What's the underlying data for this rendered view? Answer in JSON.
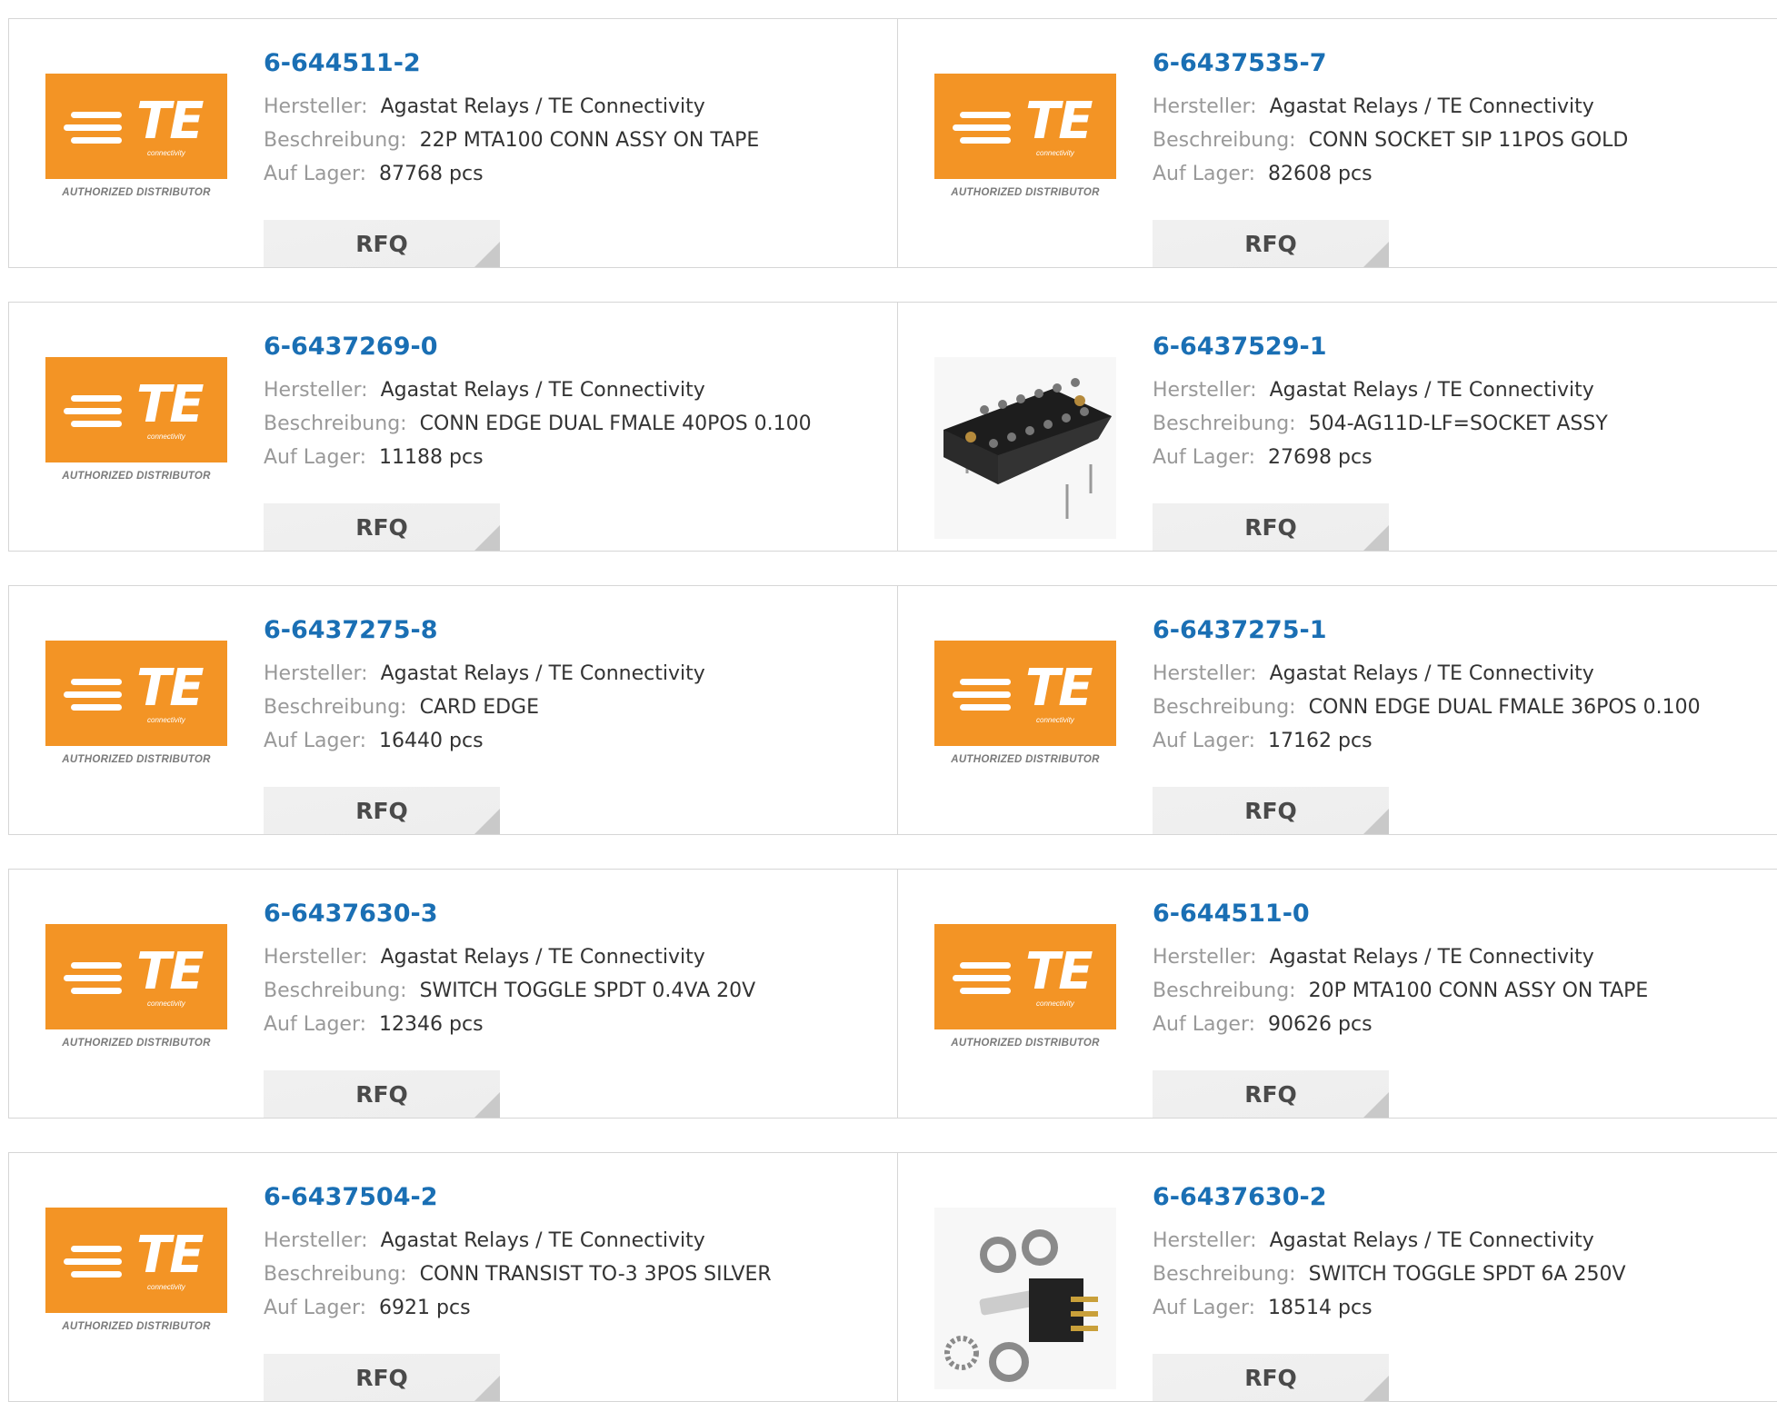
{
  "colors": {
    "brand_orange": "#f39425",
    "link_blue": "#1a6fb4",
    "label_gray": "#999999"
  },
  "logo": {
    "word": "TE",
    "sub": "connectivity",
    "authorized": "AUTHORIZED DISTRIBUTOR"
  },
  "labels": {
    "manufacturer": "Hersteller:",
    "description": "Beschreibung:",
    "stock": "Auf Lager:",
    "rfq": "RFQ"
  },
  "products": [
    {
      "part": "6-644511-2",
      "manufacturer": "Agastat Relays / TE Connectivity",
      "description": "22P MTA100 CONN ASSY ON TAPE",
      "stock": "87768 pcs",
      "image": "te-logo"
    },
    {
      "part": "6-6437535-7",
      "manufacturer": "Agastat Relays / TE Connectivity",
      "description": "CONN SOCKET SIP 11POS GOLD",
      "stock": "82608 pcs",
      "image": "te-logo"
    },
    {
      "part": "6-6437269-0",
      "manufacturer": "Agastat Relays / TE Connectivity",
      "description": "CONN EDGE DUAL FMALE 40POS 0.100",
      "stock": "11188 pcs",
      "image": "te-logo"
    },
    {
      "part": "6-6437529-1",
      "manufacturer": "Agastat Relays / TE Connectivity",
      "description": "504-AG11D-LF=SOCKET ASSY",
      "stock": "27698 pcs",
      "image": "socket-photo"
    },
    {
      "part": "6-6437275-8",
      "manufacturer": "Agastat Relays / TE Connectivity",
      "description": "CARD EDGE",
      "stock": "16440 pcs",
      "image": "te-logo"
    },
    {
      "part": "6-6437275-1",
      "manufacturer": "Agastat Relays / TE Connectivity",
      "description": "CONN EDGE DUAL FMALE 36POS 0.100",
      "stock": "17162 pcs",
      "image": "te-logo"
    },
    {
      "part": "6-6437630-3",
      "manufacturer": "Agastat Relays / TE Connectivity",
      "description": "SWITCH TOGGLE SPDT 0.4VA 20V",
      "stock": "12346 pcs",
      "image": "te-logo"
    },
    {
      "part": "6-644511-0",
      "manufacturer": "Agastat Relays / TE Connectivity",
      "description": "20P MTA100 CONN ASSY ON TAPE",
      "stock": "90626 pcs",
      "image": "te-logo"
    },
    {
      "part": "6-6437504-2",
      "manufacturer": "Agastat Relays / TE Connectivity",
      "description": "CONN TRANSIST TO-3 3POS SILVER",
      "stock": "6921 pcs",
      "image": "te-logo"
    },
    {
      "part": "6-6437630-2",
      "manufacturer": "Agastat Relays / TE Connectivity",
      "description": "SWITCH TOGGLE SPDT 6A 250V",
      "stock": "18514 pcs",
      "image": "toggle-switch-photo"
    }
  ]
}
